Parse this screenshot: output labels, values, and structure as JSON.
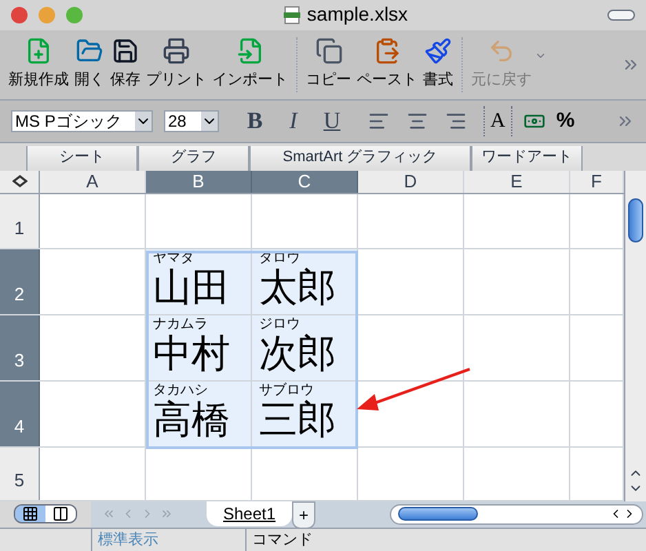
{
  "window": {
    "title": "sample.xlsx"
  },
  "toolbar": [
    {
      "kind": "new",
      "label": "新規作成",
      "disabled": false
    },
    {
      "kind": "open",
      "label": "開く",
      "disabled": false
    },
    {
      "kind": "save",
      "label": "保存",
      "disabled": false
    },
    {
      "kind": "print",
      "label": "プリント",
      "disabled": false
    },
    {
      "kind": "import",
      "label": "インポート",
      "disabled": false
    },
    {
      "kind": "copy",
      "label": "コピー",
      "disabled": false
    },
    {
      "kind": "paste",
      "label": "ペースト",
      "disabled": false
    },
    {
      "kind": "format",
      "label": "書式",
      "disabled": false
    },
    {
      "kind": "undo",
      "label": "元に戻す",
      "disabled": true
    }
  ],
  "format_bar": {
    "font": "MS Pゴシック",
    "size": "28",
    "bold": "B",
    "italic": "I",
    "underline": "U",
    "fit": "A",
    "percent": "%"
  },
  "ribbon_tabs": [
    "シート",
    "グラフ",
    "SmartArt グラフィック",
    "ワードアート"
  ],
  "columns": [
    {
      "label": "A",
      "selected": false
    },
    {
      "label": "B",
      "selected": true
    },
    {
      "label": "C",
      "selected": true
    },
    {
      "label": "D",
      "selected": false
    },
    {
      "label": "E",
      "selected": false
    },
    {
      "label": "F",
      "selected": false
    }
  ],
  "rows": [
    {
      "label": "1",
      "selected": false
    },
    {
      "label": "2",
      "selected": true,
      "names": [
        {
          "ruby": "ヤマダ",
          "text": "山田"
        },
        {
          "ruby": "タロウ",
          "text": "太郎"
        }
      ]
    },
    {
      "label": "3",
      "selected": true,
      "names": [
        {
          "ruby": "ナカムラ",
          "text": "中村"
        },
        {
          "ruby": "ジロウ",
          "text": "次郎"
        }
      ]
    },
    {
      "label": "4",
      "selected": true,
      "names": [
        {
          "ruby": "タカハシ",
          "text": "高橋"
        },
        {
          "ruby": "サブロウ",
          "text": "三郎"
        }
      ]
    },
    {
      "label": "5",
      "selected": false
    }
  ],
  "sheet_tabs": [
    {
      "label": "Sheet1",
      "selected": true
    }
  ],
  "add_sheet": "+",
  "view_buttons": [
    {
      "kind": "normal",
      "selected": true
    },
    {
      "kind": "layout",
      "selected": false
    }
  ],
  "status_bar": [
    "標準表示",
    "コマンド"
  ]
}
